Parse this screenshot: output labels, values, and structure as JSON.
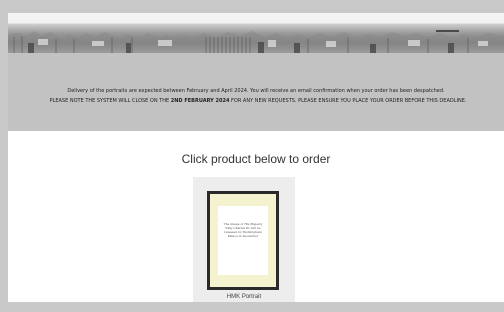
{
  "notice": {
    "line1": "Delivery of the portraits are expected between February and April 2024.  You will receive an email confirmation when your order has been despatched.",
    "line2_pre": "PLEASE NOTE THE SYSTEM WILL CLOSE ON THE ",
    "line2_bold": "2ND FEBRUARY 2024",
    "line2_post": " FOR ANY NEW REQUESTS. PLEASE ENSURE YOU PLACE YOUR ORDER BEFORE THIS DEADLINE."
  },
  "main": {
    "heading": "Click product below to order"
  },
  "product": {
    "label": "HMK Portrait",
    "image_text": "The image of His Majesty King Charles III will be released by Buckingham Palace in December"
  },
  "colors": {
    "page_bg": "#c9c9c9",
    "notice_bg": "#c2c2c2",
    "frame_black": "#2a2a2a",
    "mat": "#f4f2cf"
  }
}
